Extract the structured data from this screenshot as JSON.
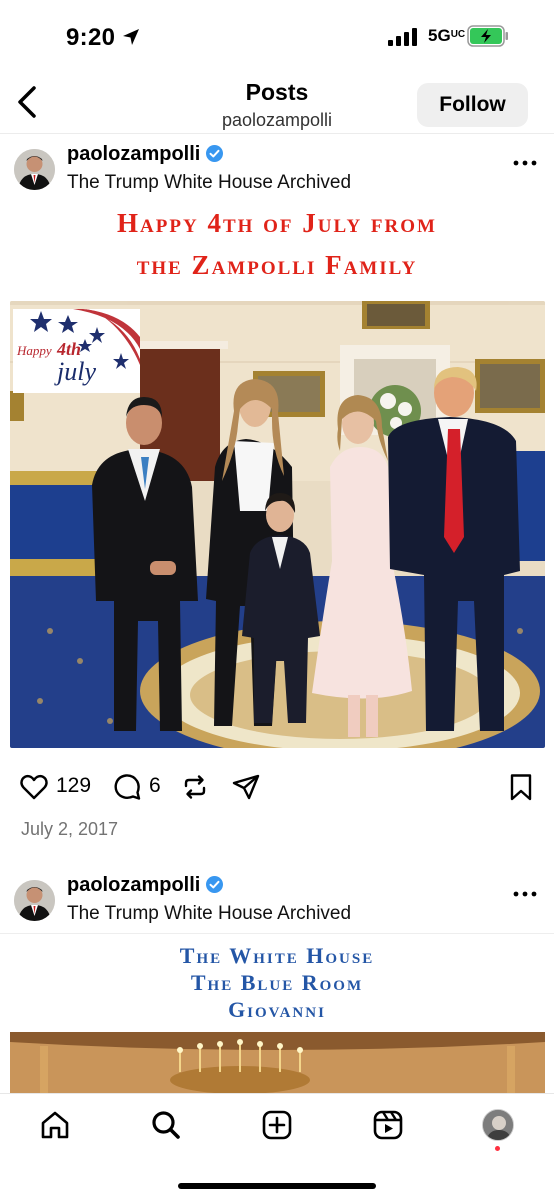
{
  "status_bar": {
    "time": "9:20",
    "network": "5G",
    "network_suffix": "UC"
  },
  "header": {
    "title": "Posts",
    "subtitle": "paolozampolli",
    "follow_label": "Follow"
  },
  "posts": [
    {
      "username": "paolozampolli",
      "verified": true,
      "location": "The Trump White House Archived",
      "image_title_line1": "Happy 4th of July from",
      "image_title_line2": "the Zampolli Family",
      "badge": {
        "happy": "Happy",
        "fourth": "4th",
        "july": "july"
      },
      "likes": "129",
      "comments": "6",
      "date": "July 2, 2017"
    },
    {
      "username": "paolozampolli",
      "verified": true,
      "location": "The Trump White House Archived",
      "image_title_lines": [
        "The White House",
        "The Blue Room",
        "Giovanni"
      ]
    }
  ],
  "icons": {
    "back": "chevron-left-icon",
    "more": "more-horizontal-icon",
    "like": "heart-icon",
    "comment": "comment-icon",
    "repost": "repost-icon",
    "share": "send-icon",
    "save": "bookmark-icon",
    "nav_home": "home-icon",
    "nav_search": "search-icon",
    "nav_create": "plus-square-icon",
    "nav_reels": "reels-icon"
  },
  "colors": {
    "verified": "#3897f0",
    "title_red": "#e02319",
    "title_blue": "#2456a6",
    "notification": "#ff3040"
  }
}
